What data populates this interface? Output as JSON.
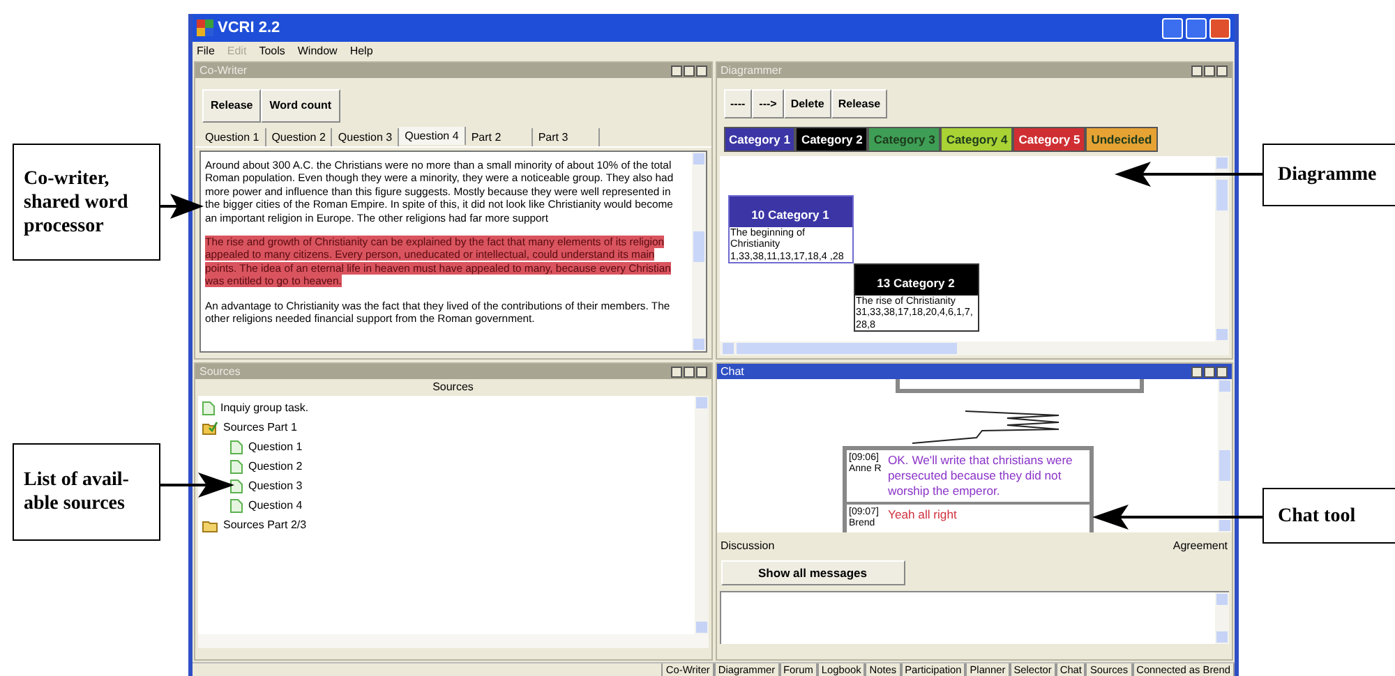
{
  "callouts_left": [
    {
      "text": "Co-writer, shared word processor"
    },
    {
      "text": "List of avail-able sources"
    }
  ],
  "callouts_right": [
    {
      "text": "Diagramme"
    },
    {
      "text": "Chat tool"
    }
  ],
  "window": {
    "title": "VCRI 2.2"
  },
  "menu": [
    {
      "label": "File",
      "disabled": false
    },
    {
      "label": "Edit",
      "disabled": true
    },
    {
      "label": "Tools",
      "disabled": false
    },
    {
      "label": "Window",
      "disabled": false
    },
    {
      "label": "Help",
      "disabled": false
    }
  ],
  "cowriter": {
    "title": "Co-Writer",
    "active": false,
    "buttons": [
      "Release",
      "Word count"
    ],
    "tabs": [
      {
        "label": "Question 1",
        "selected": false
      },
      {
        "label": "Question 2",
        "selected": false
      },
      {
        "label": "Question 3",
        "selected": false
      },
      {
        "label": "Question 4",
        "selected": true
      },
      {
        "label": "Part 2",
        "selected": false
      },
      {
        "label": "Part 3",
        "selected": false
      }
    ],
    "paragraphs": [
      {
        "text": "Around about 300 A.C. the Christians were no more than a small minority of about 10% of the total Roman population. Even though they were a minority, they were a noticeable group. They also had more power and influence than this figure suggests. Mostly because they were well represented in the bigger cities of the Roman Empire. In spite of this, it did not look like Christianity would become an important religion in Europe. The other religions had far more support",
        "highlighted": false
      },
      {
        "text": "The rise and growth of Christianity can be explained by the fact that many elements of its religion appealed to many citizens. Every person, uneducated or intellectual, could understand its main points. The idea of an eternal life in heaven must have appealed to many, because every Christian was entitled to go to heaven.",
        "highlighted": true
      },
      {
        "text": "An advantage to Christianity was the fact that they lived of the contributions of their members. The other religions needed financial support from the Roman government.",
        "highlighted": false
      }
    ]
  },
  "diagrammer": {
    "title": "Diagrammer",
    "active": false,
    "buttons": [
      "----",
      "--->",
      "Delete",
      "Release"
    ],
    "categories": [
      {
        "label": "Category 1",
        "color": "#3b35a6"
      },
      {
        "label": "Category 2",
        "color": "#000000"
      },
      {
        "label": "Category 3",
        "color": "#3f9e55"
      },
      {
        "label": "Category 4",
        "color": "#a9d234"
      },
      {
        "label": "Category 5",
        "color": "#cf2f33"
      },
      {
        "label": "Undecided",
        "color": "#e6a233"
      }
    ],
    "nodes": [
      {
        "header": "10 Category 1",
        "color": "#3b35a6",
        "title": "The beginning of Christianity",
        "numbers": "1,33,38,11,13,17,18,4 ,28"
      },
      {
        "header": "13 Category 2",
        "color": "#000000",
        "title": "The rise of Christianity",
        "numbers": "31,33,38,17,18,20,4,6,1,7,28,8"
      }
    ]
  },
  "sources": {
    "title": "Sources",
    "active": false,
    "column": "Sources",
    "tree": [
      {
        "label": "Inquiy group task.",
        "kind": "document"
      },
      {
        "label": "Sources Part 1",
        "kind": "folder",
        "expanded": true,
        "children": [
          {
            "label": "Question 1",
            "kind": "document"
          },
          {
            "label": "Question 2",
            "kind": "document"
          },
          {
            "label": "Question 3",
            "kind": "document"
          },
          {
            "label": "Question 4",
            "kind": "document"
          }
        ]
      },
      {
        "label": "Sources Part 2/3",
        "kind": "folder",
        "expanded": false
      }
    ]
  },
  "chat": {
    "title": "Chat",
    "active": true,
    "messages": [
      {
        "time": "[09:06]",
        "author": "Anne R",
        "text": "OK. We'll write that christians were persecuted because they did not worship the emperor.",
        "color": "#8a32c8"
      },
      {
        "time": "[09:07]",
        "author": "Brend",
        "text": "Yeah all right",
        "color": "#d0303c"
      }
    ],
    "left_label": "Discussion",
    "right_label": "Agreement",
    "button": "Show all messages"
  },
  "status_bar": {
    "items": [
      "Co-Writer",
      "Diagrammer",
      "Forum",
      "Logbook",
      "Notes",
      "Participation",
      "Planner",
      "Selector",
      "Chat",
      "Sources",
      "Connected as Brend"
    ]
  }
}
